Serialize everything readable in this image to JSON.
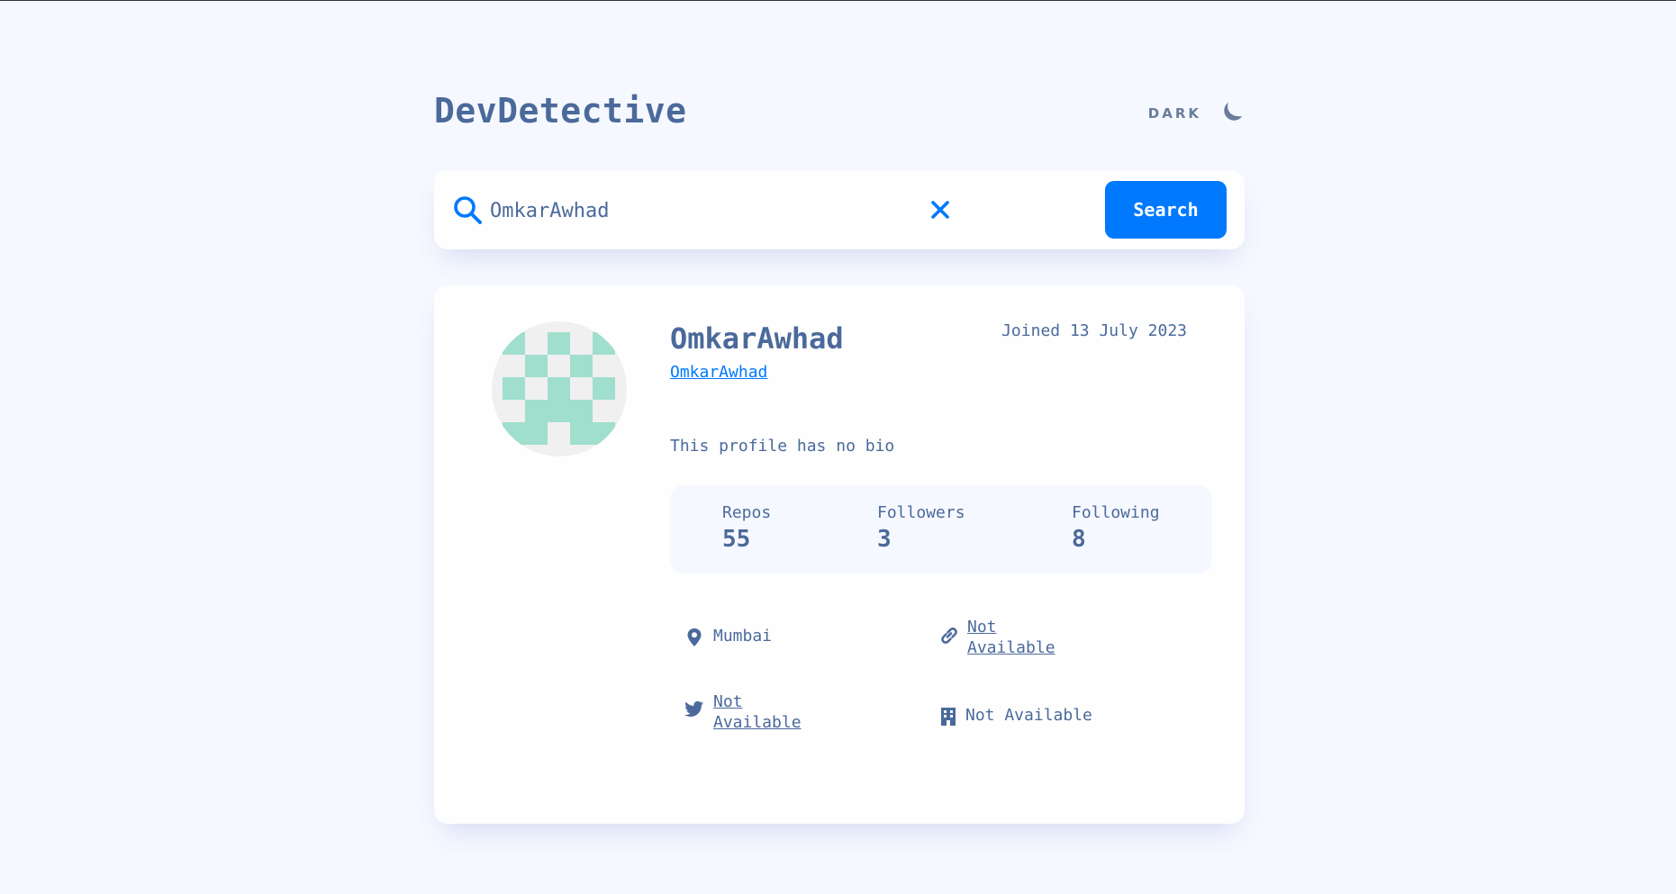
{
  "header": {
    "logo": "DevDetective",
    "theme_label": "DARK",
    "theme_icon": "moon-icon"
  },
  "search": {
    "value": "OmkarAwhad",
    "button_label": "Search",
    "search_icon": "search-icon",
    "clear_icon": "close-icon"
  },
  "profile": {
    "name": "OmkarAwhad",
    "login": "OmkarAwhad",
    "joined": "Joined 13 July 2023",
    "bio": "This profile has no bio"
  },
  "stats": {
    "repos_label": "Repos",
    "repos_value": "55",
    "followers_label": "Followers",
    "followers_value": "3",
    "following_label": "Following",
    "following_value": "8"
  },
  "info": {
    "location": "Mumbai",
    "website": "Not Available",
    "twitter": "Not Available",
    "company": "Not Available"
  },
  "colors": {
    "background": "#f6f8ff",
    "card": "#fefefe",
    "accent": "#0079ff",
    "text": "#4b6a9b",
    "avatar_fill": "#a0dece",
    "avatar_bg": "#f0f0f0"
  }
}
